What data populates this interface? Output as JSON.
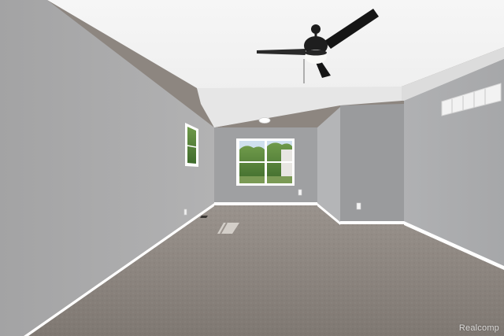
{
  "photo": {
    "watermark": "Realcomp",
    "colors": {
      "wall_left": "#a9a9a9",
      "wall_back": "#9e9fa1",
      "wall_right": "#a8a9ab",
      "ceiling": "#f4f4f4",
      "carpet": "#8a837d",
      "trim": "#ffffff",
      "fan": "#1c1c1c"
    }
  }
}
